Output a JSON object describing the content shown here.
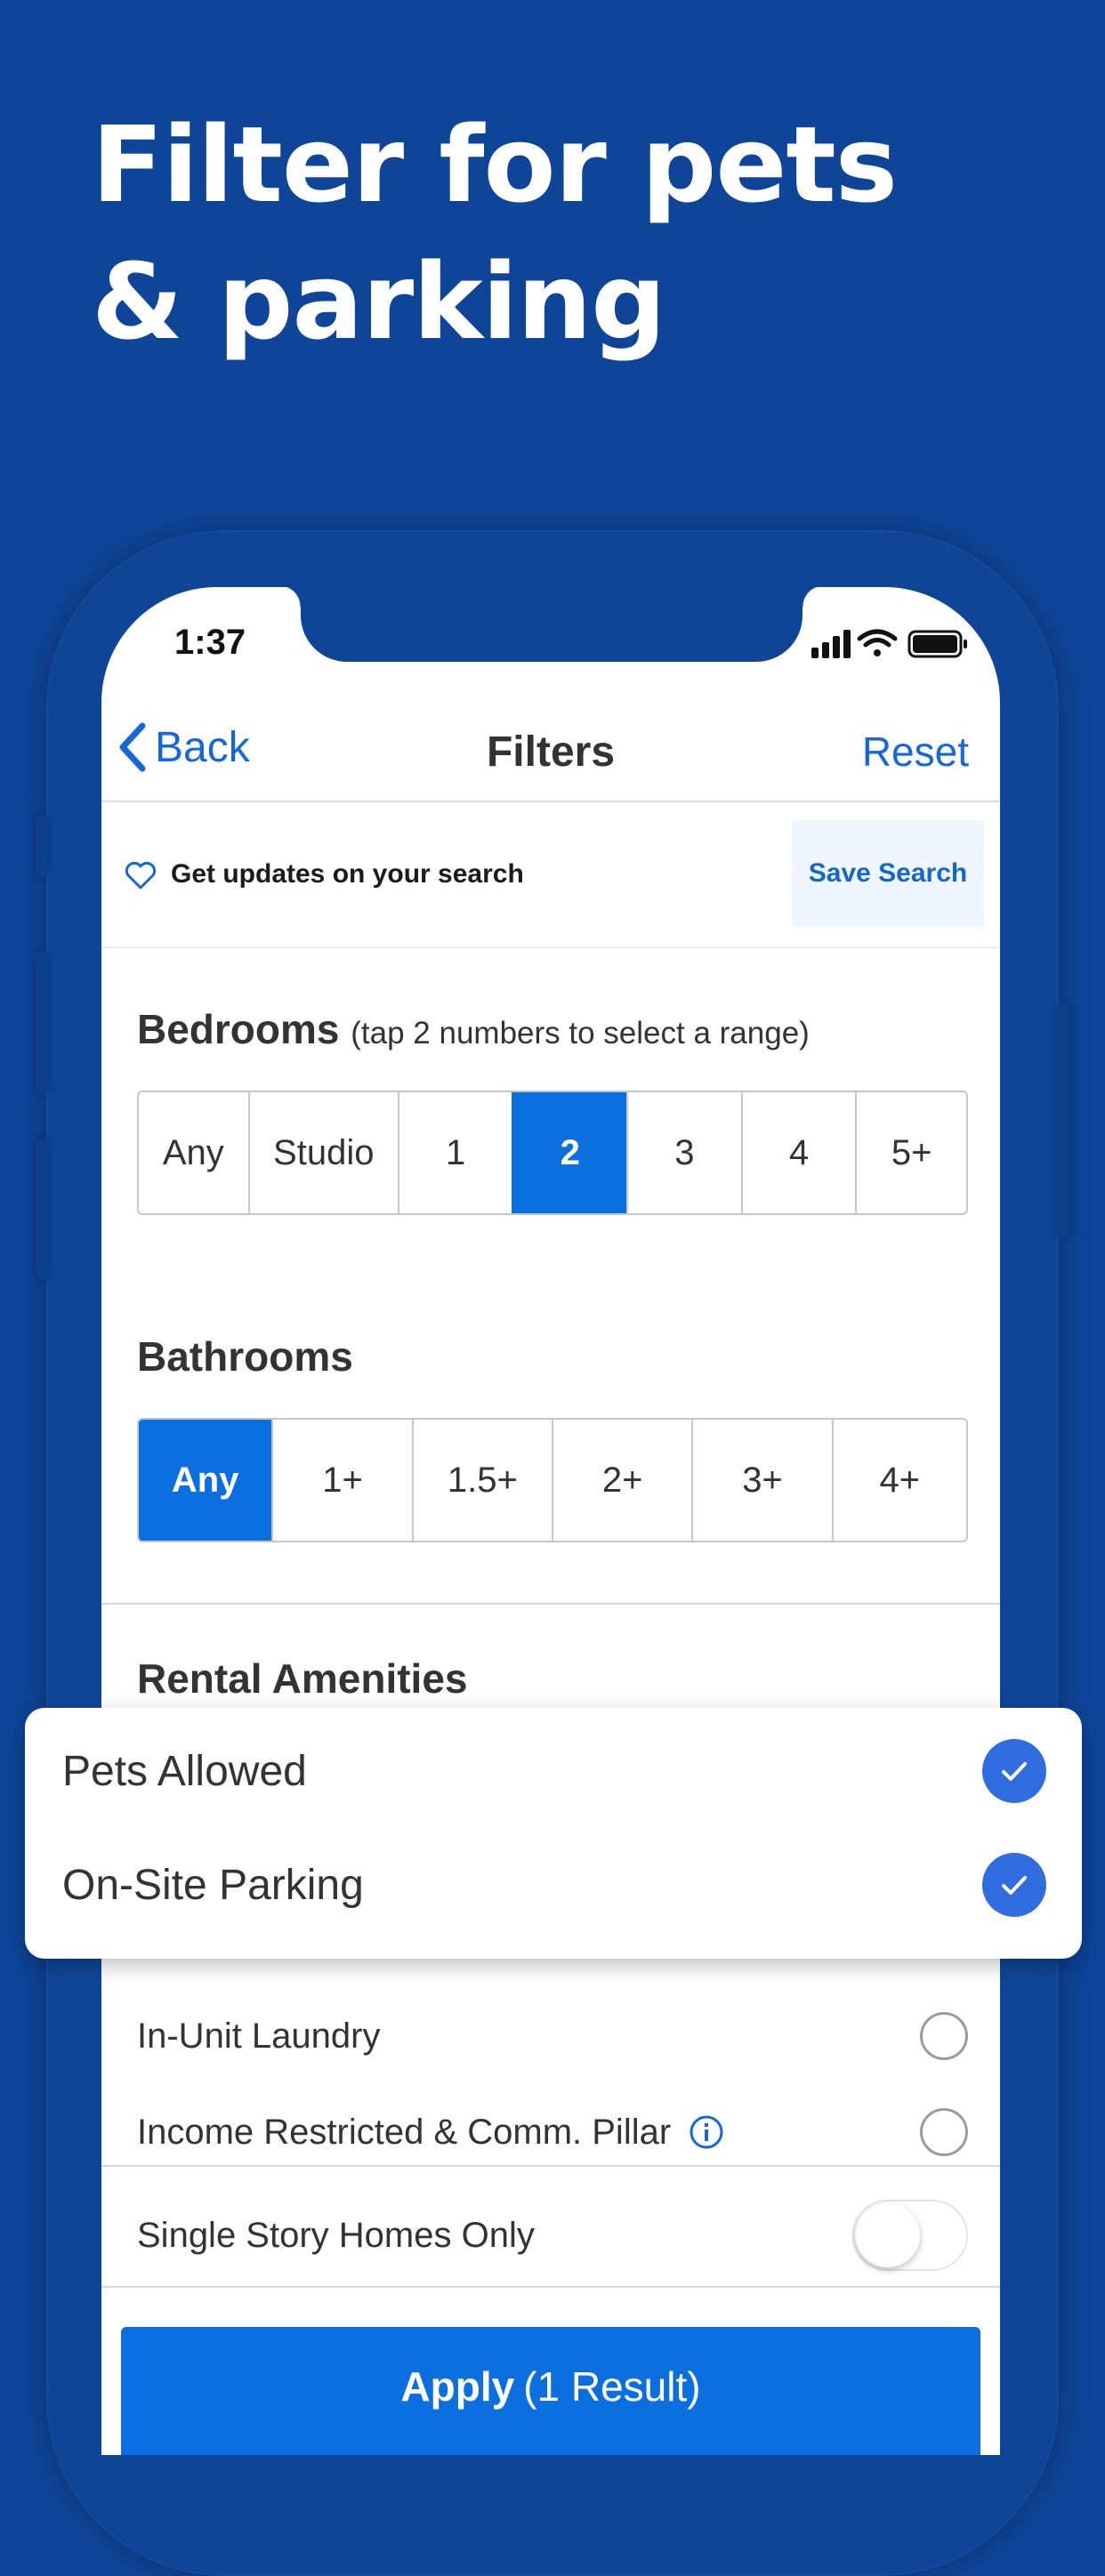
{
  "headline": {
    "line1": "Filter for pets",
    "line2": "& parking"
  },
  "status_bar": {
    "time": "1:37"
  },
  "nav": {
    "back_label": "Back",
    "title": "Filters",
    "reset_label": "Reset"
  },
  "save_bar": {
    "text": "Get updates on your search",
    "button_label": "Save Search"
  },
  "bedrooms": {
    "title": "Bedrooms",
    "hint": "(tap 2 numbers to select a range)",
    "options": [
      "Any",
      "Studio",
      "1",
      "2",
      "3",
      "4",
      "5+"
    ],
    "selected": "2"
  },
  "bathrooms": {
    "title": "Bathrooms",
    "options": [
      "Any",
      "1+",
      "1.5+",
      "2+",
      "3+",
      "4+"
    ],
    "selected": "Any"
  },
  "amenities": {
    "title": "Rental Amenities",
    "highlighted": [
      {
        "label": "Pets Allowed",
        "checked": true
      },
      {
        "label": "On-Site Parking",
        "checked": true
      }
    ],
    "items": [
      {
        "label": "In-Unit Laundry",
        "checked": false
      },
      {
        "label": "Income Restricted & Comm. Pillar",
        "checked": false
      }
    ],
    "single_story": {
      "label": "Single Story Homes Only",
      "on": false
    }
  },
  "apply": {
    "label": "Apply",
    "result": "(1 Result)"
  },
  "colors": {
    "background": "#0e4599",
    "accent": "#0c6fe0",
    "link": "#1667d8",
    "check": "#2f6de0"
  }
}
